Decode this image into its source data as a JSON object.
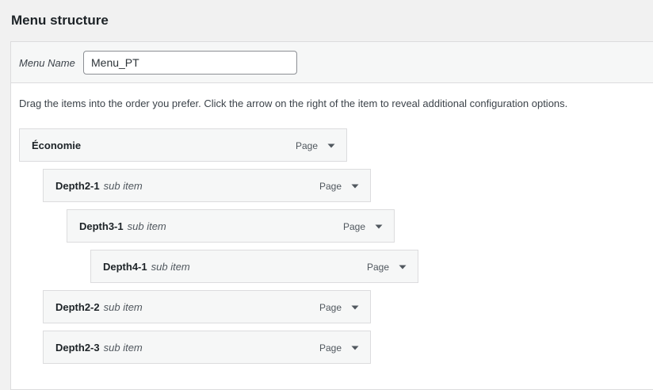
{
  "heading": "Menu structure",
  "menu_name": {
    "label": "Menu Name",
    "value": "Menu_PT"
  },
  "instructions": "Drag the items into the order you prefer. Click the arrow on the right of the item to reveal additional configuration options.",
  "items": [
    {
      "title": "Économie",
      "sub": "",
      "type": "Page",
      "depth": 1
    },
    {
      "title": "Depth2-1",
      "sub": "sub item",
      "type": "Page",
      "depth": 2
    },
    {
      "title": "Depth3-1",
      "sub": "sub item",
      "type": "Page",
      "depth": 3
    },
    {
      "title": "Depth4-1",
      "sub": "sub item",
      "type": "Page",
      "depth": 4
    },
    {
      "title": "Depth2-2",
      "sub": "sub item",
      "type": "Page",
      "depth": 2
    },
    {
      "title": "Depth2-3",
      "sub": "sub item",
      "type": "Page",
      "depth": 2
    }
  ],
  "icons": {
    "toggle": "triangle-down-icon"
  }
}
